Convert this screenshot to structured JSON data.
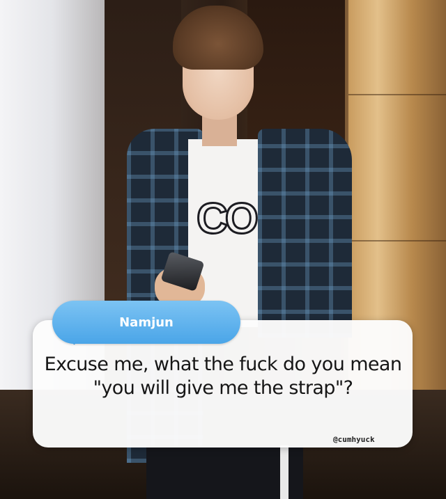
{
  "dialog": {
    "speaker": "Namjun",
    "line": "Excuse me, what the fuck do you mean \"you will give me the strap\"?"
  },
  "shirt_print": "CO",
  "watermark": "@cumhyuck",
  "colors": {
    "name_tab": "#4aa5e8",
    "dialog_bg": "#fcfcfc",
    "text": "#161616"
  }
}
